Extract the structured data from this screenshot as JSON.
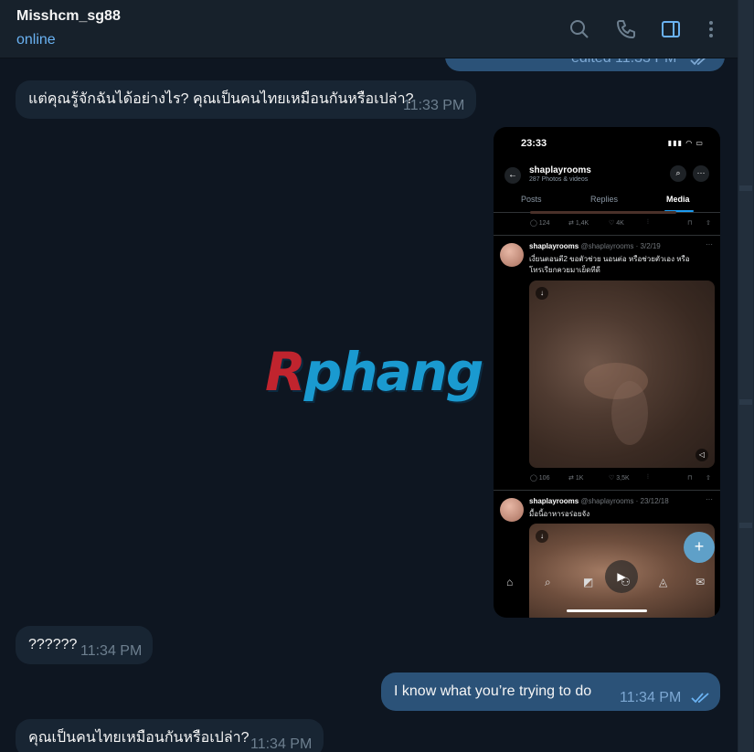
{
  "header": {
    "name": "Misshcm_sg88",
    "status": "online",
    "icons": [
      "search-icon",
      "phone-icon",
      "sidebar-toggle-icon",
      "more-vertical-icon"
    ]
  },
  "messages": [
    {
      "id": "m0",
      "direction": "out",
      "text": "",
      "meta": "edited 11:33 PM",
      "partial": true
    },
    {
      "id": "m1",
      "direction": "in",
      "text": "แต่คุณรู้จักฉันได้อย่างไร? คุณเป็นคนไทยเหมือนกันหรือเปล่า?",
      "time": "11:33 PM"
    },
    {
      "id": "m2",
      "direction": "in",
      "text": "??????",
      "time": "11:34 PM"
    },
    {
      "id": "m3",
      "direction": "out",
      "text": "I know what you’re trying to do",
      "time": "11:34 PM"
    },
    {
      "id": "m4",
      "direction": "in",
      "text": "คุณเป็นคนไทยเหมือนกันหรือเปล่า?",
      "time": "11:34 PM"
    }
  ],
  "screenshot": {
    "time": "23:33",
    "profile_name": "shaplayrooms",
    "profile_sub": "287 Photos & videos",
    "tabs": [
      "Posts",
      "Replies",
      "Media"
    ],
    "active_tab": "Media",
    "top_stats": {
      "replies": "124",
      "reposts": "1,4K",
      "likes": "4K"
    },
    "posts": [
      {
        "name": "shaplayrooms",
        "handle_date": "@shaplayrooms · 3/2/19",
        "text_line1": "เงี่ยนตอนตี2 ขอตัวช่วย นอนต่อ หรือช่วยตัวเอง หรือ",
        "text_line2": "โทรเรียกควยมาเย็ดทีดี",
        "stats": {
          "replies": "106",
          "reposts": "1K",
          "likes": "3,5K"
        }
      },
      {
        "name": "shaplayrooms",
        "handle_date": "@shaplayrooms · 23/12/18",
        "text_line1": "มื้อนี้อาหารอร่อยจัง"
      }
    ]
  },
  "watermark": {
    "text_r": "R",
    "text_rest": "phang"
  },
  "colors": {
    "background": "#0e1621",
    "incoming_bubble": "#182533",
    "outgoing_bubble": "#2b5278",
    "accent": "#6ab2f2"
  }
}
